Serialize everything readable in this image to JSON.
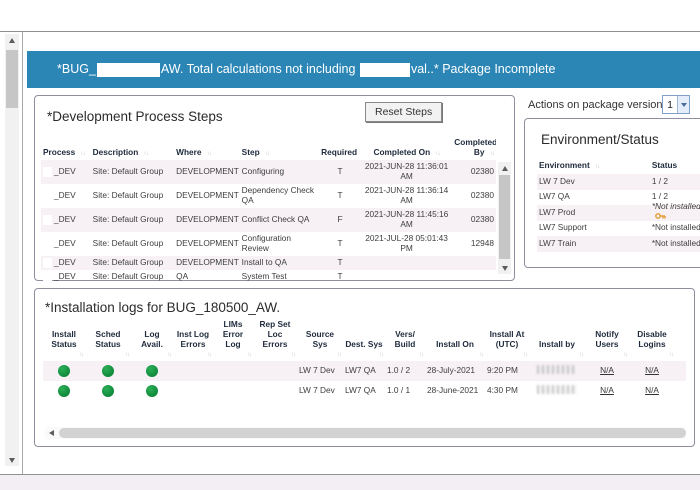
{
  "window": {
    "colors": {
      "header_bg": "#2b86b6",
      "status_green": "#128a3c",
      "row_alt": "#f7f1f6"
    },
    "header": {
      "title_segments": [
        {
          "text": "*BUG_"
        },
        {
          "redacted": true,
          "width": 63
        },
        {
          "text": "AW. Total calculations not including "
        },
        {
          "redacted": true,
          "width": 50
        },
        {
          "text": "val..* Package Incomplete"
        }
      ]
    }
  },
  "dev_steps": {
    "title": "*Development Process Steps",
    "reset_button": "Reset Steps",
    "columns": [
      "Process",
      "Description",
      "Where",
      "Step",
      "Required",
      "Completed On",
      "Completed By"
    ],
    "rows": [
      {
        "process": "_DEV",
        "description": "Site: Default Group",
        "where": "DEVELOPMENT",
        "step": "Configuring",
        "required": "T",
        "completed_on": "2021-JUN-28 11:36:01 AM",
        "completed_by": "02380"
      },
      {
        "process": "_DEV",
        "description": "Site: Default Group",
        "where": "DEVELOPMENT",
        "step": "Dependency Check QA",
        "required": "T",
        "completed_on": "2021-JUN-28 11:36:14 AM",
        "completed_by": "02380"
      },
      {
        "process": "_DEV",
        "description": "Site: Default Group",
        "where": "DEVELOPMENT",
        "step": "Conflict Check QA",
        "required": "F",
        "completed_on": "2021-JUN-28 11:45:16 AM",
        "completed_by": "02380"
      },
      {
        "process": "_DEV",
        "description": "Site: Default Group",
        "where": "DEVELOPMENT",
        "step": "Configuration Review",
        "required": "T",
        "completed_on": "2021-JUL-28 05:01:43 PM",
        "completed_by": "12948"
      },
      {
        "process": "_DEV",
        "description": "Site: Default Group",
        "where": "DEVELOPMENT",
        "step": "Install to QA",
        "required": "T",
        "completed_on": "",
        "completed_by": ""
      },
      {
        "process": "_DEV",
        "description": "Site: Default Group",
        "where": "QA",
        "step": "System Test",
        "required": "T",
        "completed_on": "",
        "completed_by": ""
      }
    ]
  },
  "actions": {
    "label": "Actions on package version:",
    "selected": "1"
  },
  "environment": {
    "title": "Environment/Status",
    "columns": [
      "Environment",
      "Status"
    ],
    "rows": [
      {
        "environment": "LW 7 Dev",
        "status": "1 / 2",
        "italic": false,
        "icon": ""
      },
      {
        "environment": "LW7 QA",
        "status": "1 / 2",
        "italic": false,
        "icon": ""
      },
      {
        "environment": "LW7 Prod",
        "status": "*Not installed",
        "italic": true,
        "icon": "key-icon"
      },
      {
        "environment": "LW7 Support",
        "status": "*Not installed",
        "italic": false,
        "icon": ""
      },
      {
        "environment": "LW7 Train",
        "status": "*Not installed",
        "italic": false,
        "icon": ""
      }
    ]
  },
  "install_logs": {
    "title": "*Installation logs for BUG_180500_AW.",
    "columns": [
      "Install Status",
      "Sched Status",
      "Log Avail.",
      "Inst Log Errors",
      "LIMs Error Log",
      "Rep Set Loc Errors",
      "Source Sys",
      "Dest. Sys",
      "Vers/ Build",
      "Install On",
      "Install At (UTC)",
      "Install by",
      "Notify Users",
      "Disable Logins"
    ],
    "rows": [
      {
        "install_status": "green",
        "sched_status": "green",
        "log_avail": "green",
        "inst_log_errors": "",
        "lims_error_log": "",
        "rep_set_loc_errors": "",
        "source_sys": "LW 7 Dev",
        "dest_sys": "LW7 QA",
        "vers_build": "1.0 / 2",
        "install_on": "28-July-2021",
        "install_at": "9:20 PM",
        "install_by": "",
        "install_by_redacted": true,
        "notify_users": "N/A",
        "disable_logins": "N/A"
      },
      {
        "install_status": "green",
        "sched_status": "green",
        "log_avail": "green",
        "inst_log_errors": "",
        "lims_error_log": "",
        "rep_set_loc_errors": "",
        "source_sys": "LW 7 Dev",
        "dest_sys": "LW7 QA",
        "vers_build": "1.0 / 1",
        "install_on": "28-June-2021",
        "install_at": "4:30 PM",
        "install_by": "",
        "install_by_redacted": true,
        "notify_users": "N/A",
        "disable_logins": "N/A"
      }
    ]
  }
}
